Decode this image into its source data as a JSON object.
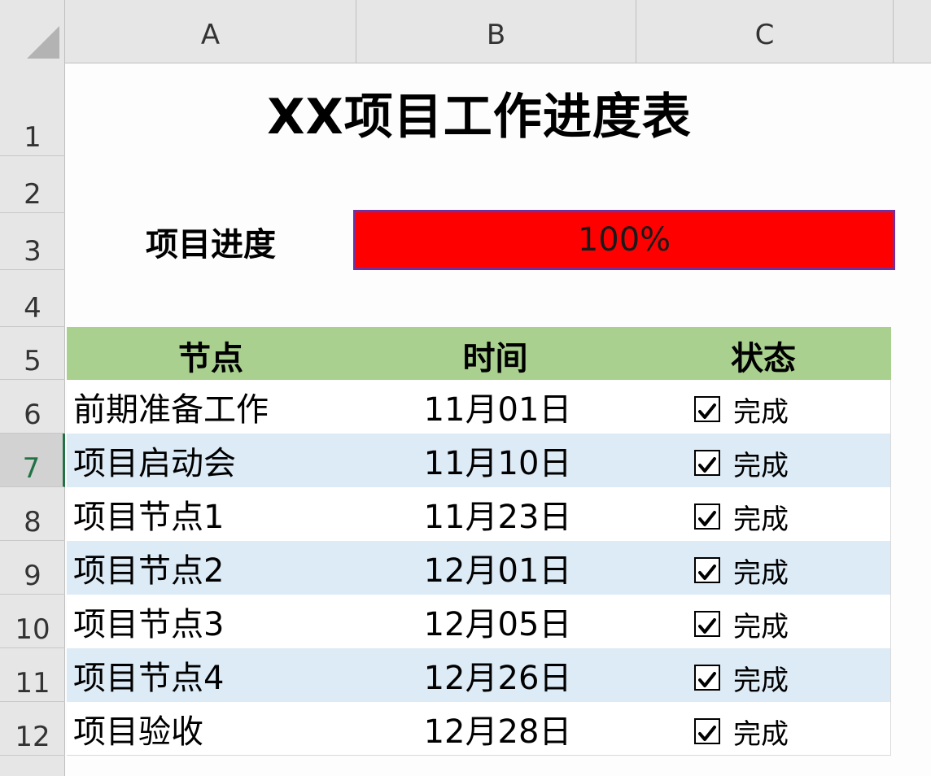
{
  "columns": [
    "A",
    "B",
    "C"
  ],
  "rows": [
    "1",
    "2",
    "3",
    "4",
    "5",
    "6",
    "7",
    "8",
    "9",
    "10",
    "11",
    "12"
  ],
  "selected_row": "7",
  "title": "XX项目工作进度表",
  "progress": {
    "label": "项目进度",
    "value_text": "100%",
    "value": 1.0,
    "fill_color": "#ff0000",
    "border_color": "#7030a0"
  },
  "table": {
    "header_color": "#a9d08e",
    "band_color": "#ddebf7",
    "headers": [
      "节点",
      "时间",
      "状态"
    ],
    "rows": [
      {
        "node": "前期准备工作",
        "time": "11月01日",
        "status": "完成",
        "checked": true
      },
      {
        "node": "项目启动会",
        "time": "11月10日",
        "status": "完成",
        "checked": true
      },
      {
        "node": "项目节点1",
        "time": "11月23日",
        "status": "完成",
        "checked": true
      },
      {
        "node": "项目节点2",
        "time": "12月01日",
        "status": "完成",
        "checked": true
      },
      {
        "node": "项目节点3",
        "time": "12月05日",
        "status": "完成",
        "checked": true
      },
      {
        "node": "项目节点4",
        "time": "12月26日",
        "status": "完成",
        "checked": true
      },
      {
        "node": "项目验收",
        "time": "12月28日",
        "status": "完成",
        "checked": true
      }
    ]
  }
}
